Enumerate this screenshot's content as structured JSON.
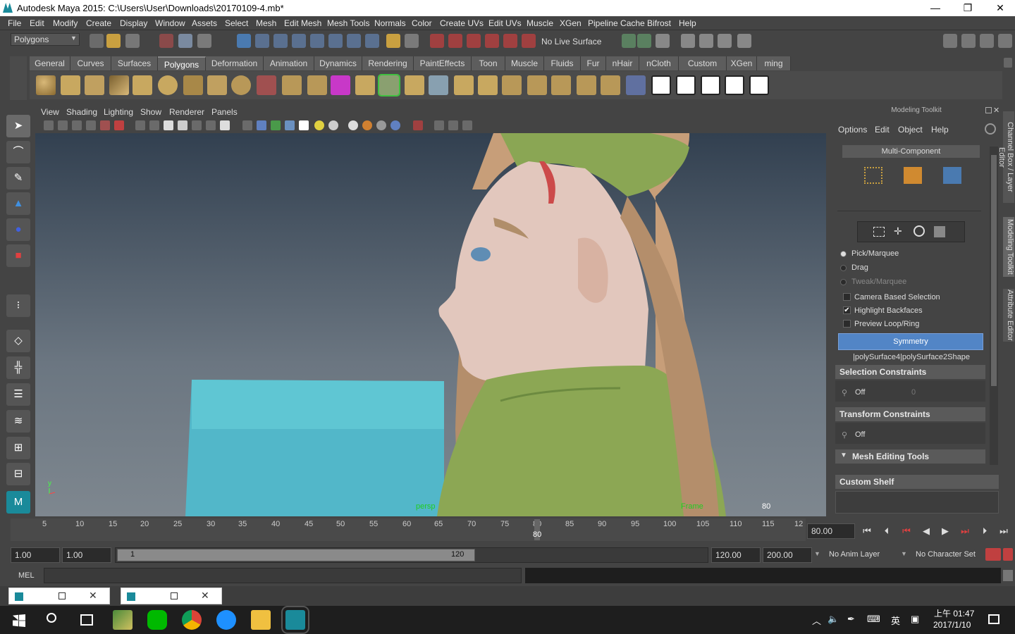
{
  "window": {
    "title": "Autodesk Maya 2015: C:\\Users\\User\\Downloads\\20170109-4.mb*",
    "min": "—",
    "max": "❐",
    "close": "✕"
  },
  "menubar": [
    "File",
    "Edit",
    "Modify",
    "Create",
    "Display",
    "Window",
    "Assets",
    "Select",
    "Mesh",
    "Edit Mesh",
    "Mesh Tools",
    "Normals",
    "Color",
    "Create UVs",
    "Edit UVs",
    "Muscle",
    "XGen",
    "Pipeline Cache",
    "Bifrost",
    "Help"
  ],
  "status": {
    "mode": "Polygons",
    "live_surface": "No Live Surface"
  },
  "shelf_tabs": [
    "General",
    "Curves",
    "Surfaces",
    "Polygons",
    "Deformation",
    "Animation",
    "Dynamics",
    "Rendering",
    "PaintEffects",
    "Toon",
    "Muscle",
    "Fluids",
    "Fur",
    "nHair",
    "nCloth",
    "Custom",
    "XGen",
    "ming"
  ],
  "shelf_active": "Polygons",
  "panel_menu": [
    "View",
    "Shading",
    "Lighting",
    "Show",
    "Renderer",
    "Panels"
  ],
  "viewport": {
    "camera": "persp",
    "frame_label": "Frame",
    "frame_value": "80"
  },
  "modeling_toolkit": {
    "title": "Modeling Toolkit",
    "menu": [
      "Options",
      "Edit",
      "Object",
      "Help"
    ],
    "multi_component": "Multi-Component",
    "pick_options": [
      "Pick/Marquee",
      "Drag",
      "Tweak/Marquee"
    ],
    "checks": [
      {
        "label": "Camera Based Selection",
        "checked": false
      },
      {
        "label": "Highlight Backfaces",
        "checked": true
      },
      {
        "label": "Preview Loop/Ring",
        "checked": false
      }
    ],
    "symmetry": "Symmetry",
    "object_path": "|polySurface4|polySurface2Shape",
    "selection_constraints": "Selection Constraints",
    "sel_off": "Off",
    "sel_value": "0",
    "transform_constraints": "Transform Constraints",
    "trans_off": "Off",
    "mesh_editing_tools": "Mesh Editing Tools",
    "custom_shelf": "Custom Shelf"
  },
  "side_tabs": [
    "Channel Box / Layer Editor",
    "Modeling Toolkit",
    "Attribute Editor"
  ],
  "timeline": {
    "ticks": [
      "5",
      "10",
      "15",
      "20",
      "25",
      "30",
      "35",
      "40",
      "45",
      "50",
      "55",
      "60",
      "65",
      "70",
      "75",
      "80",
      "85",
      "90",
      "95",
      "100",
      "105",
      "110",
      "115",
      "12"
    ],
    "current": "80",
    "current_field": "80.00"
  },
  "range": {
    "start": "1.00",
    "start2": "1.00",
    "slider_start": "1",
    "slider_end": "120",
    "end": "120.00",
    "end2": "200.00",
    "anim_layer": "No Anim Layer",
    "char_set": "No Character Set"
  },
  "cmd": {
    "label": "MEL"
  },
  "taskbar": {
    "time": "上午 01:47",
    "date": "2017/1/10",
    "ime": "英"
  }
}
